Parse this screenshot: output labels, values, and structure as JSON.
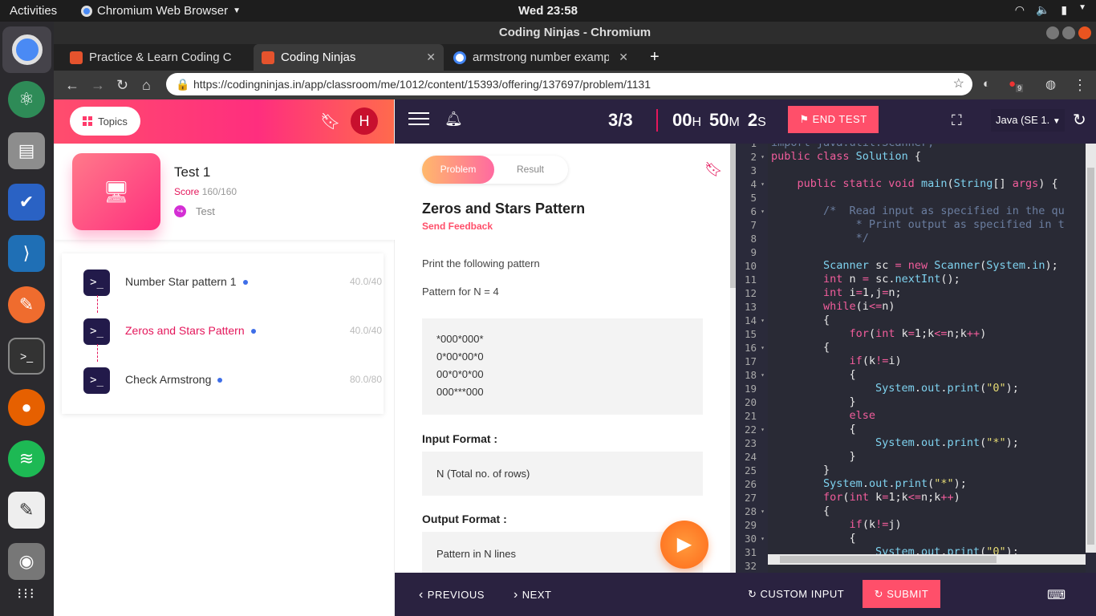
{
  "system": {
    "activities": "Activities",
    "app_name": "Chromium Web Browser",
    "clock": "Wed 23:58"
  },
  "window": {
    "title": "Coding Ninjas - Chromium"
  },
  "browser_tabs": [
    {
      "label": "Practice & Learn Coding C"
    },
    {
      "label": "Coding Ninjas"
    },
    {
      "label": "armstrong number examp"
    }
  ],
  "address": {
    "url": "https://codingninjas.in/app/classroom/me/1012/content/15393/offering/137697/problem/1131"
  },
  "extension_badge": "9",
  "left": {
    "topics_label": "Topics",
    "avatar_letter": "H",
    "test_title": "Test 1",
    "score_label": "Score",
    "score_value": "160/160",
    "test_tag": "Test",
    "problems": [
      {
        "name": "Number Star pattern 1",
        "score": "40.0/40"
      },
      {
        "name": "Zeros and Stars Pattern",
        "score": "40.0/40"
      },
      {
        "name": "Check Armstrong",
        "score": "80.0/80"
      }
    ]
  },
  "header": {
    "question_count": "3/3",
    "hours": "00",
    "hours_unit": "H",
    "minutes": "50",
    "minutes_unit": "M",
    "seconds": "2",
    "seconds_unit": "S",
    "end_test": "END TEST",
    "language": "Java (SE 1.",
    "language_arrow": "▼"
  },
  "problem": {
    "tab_problem": "Problem",
    "tab_result": "Result",
    "title": "Zeros and Stars Pattern",
    "feedback": "Send Feedback",
    "description": "Print the following pattern",
    "pattern_for": "Pattern for N = 4",
    "pattern_lines": [
      "*000*000*",
      "0*00*00*0",
      "00*0*0*00",
      "000***000"
    ],
    "input_format_label": "Input Format :",
    "input_format": "N (Total no. of rows)",
    "output_format_label": "Output Format :",
    "output_format": "Pattern in N lines"
  },
  "footer": {
    "previous": "PREVIOUS",
    "next": "NEXT",
    "custom_input": "CUSTOM INPUT",
    "submit": "SUBMIT"
  }
}
